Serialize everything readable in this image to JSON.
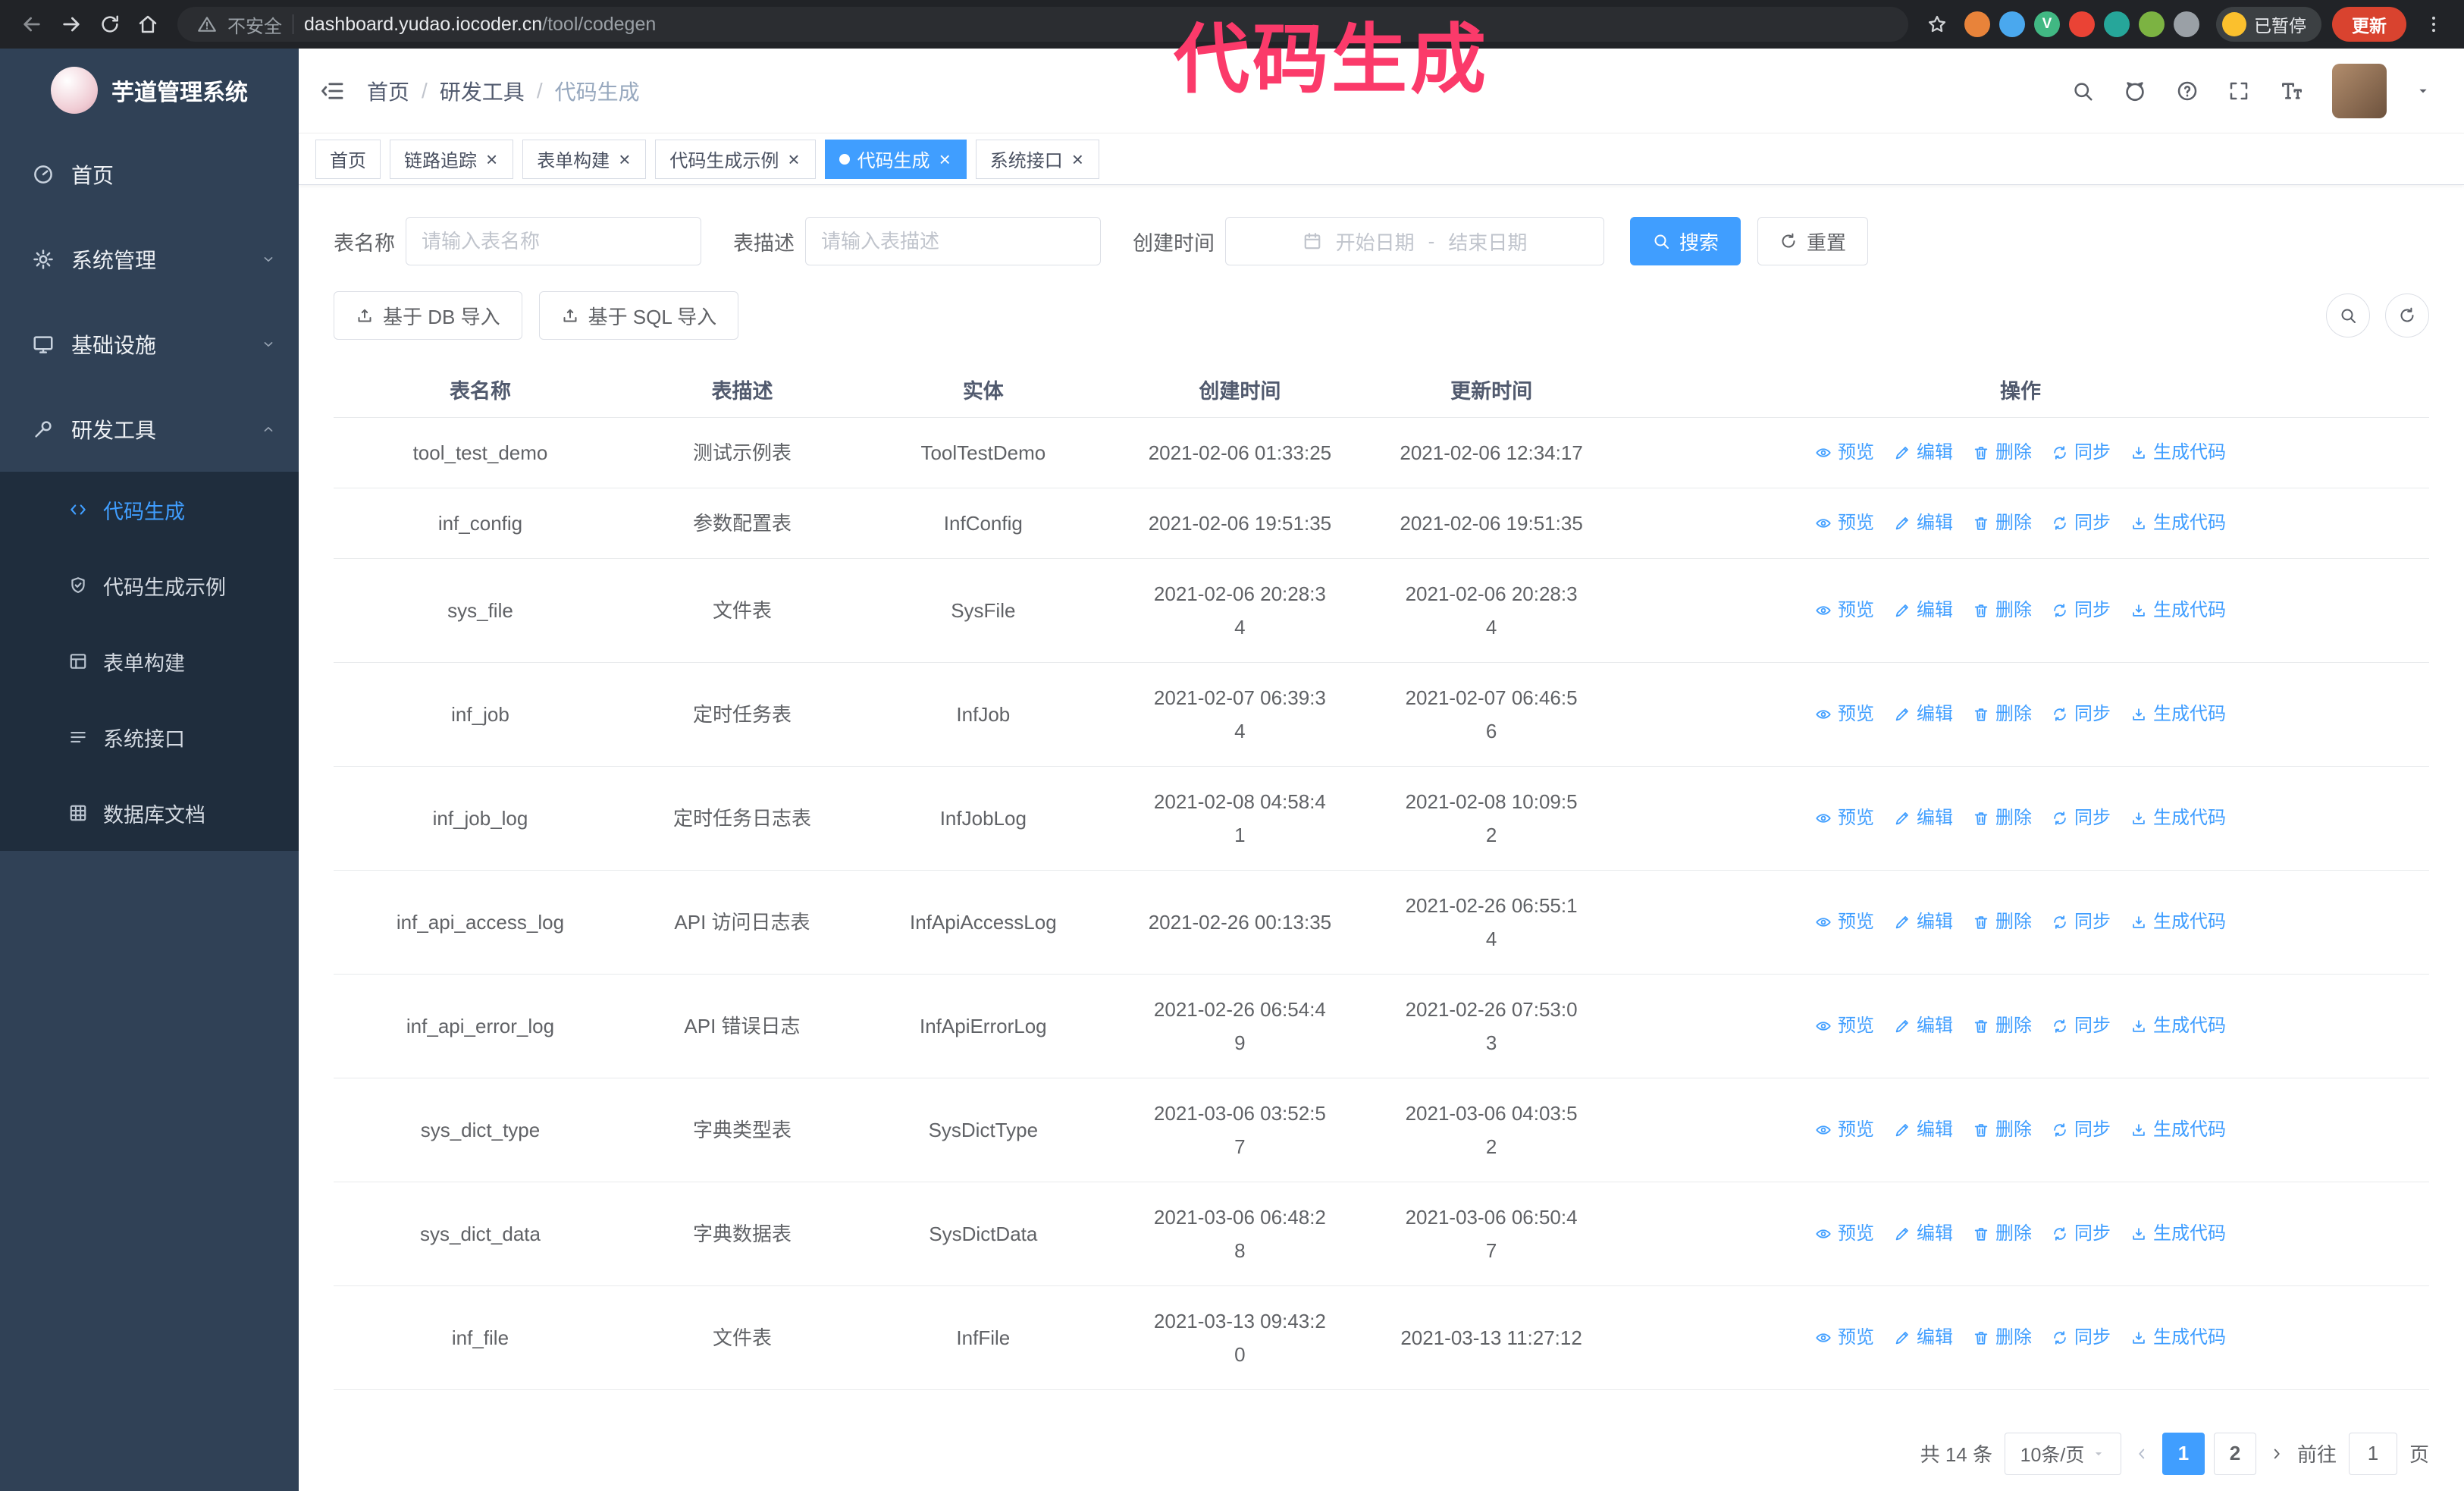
{
  "annotation": {
    "text": "代码生成"
  },
  "browser": {
    "security_label": "不安全",
    "url_host": "dashboard.yudao.iocoder.cn",
    "url_path": "/tool/codegen",
    "paused_badge": "已暂停",
    "update_label": "更新",
    "extensions": [
      {
        "name": "extension-1",
        "color": "#e8833a",
        "label": ""
      },
      {
        "name": "extension-2",
        "color": "#4aa8ee",
        "label": ""
      },
      {
        "name": "extension-3",
        "color": "#41b883",
        "label": "V"
      },
      {
        "name": "extension-4",
        "color": "#ea4335",
        "label": ""
      },
      {
        "name": "extension-5",
        "color": "#26a69a",
        "label": ""
      },
      {
        "name": "extension-6",
        "color": "#7cb342",
        "label": ""
      },
      {
        "name": "extension-7",
        "color": "#9aa0a6",
        "label": ""
      }
    ]
  },
  "sidebar": {
    "title": "芋道管理系统",
    "menu": [
      {
        "label": "首页",
        "icon": "dashboard",
        "arrow": ""
      },
      {
        "label": "系统管理",
        "icon": "gear",
        "arrow": "down"
      },
      {
        "label": "基础设施",
        "icon": "infra",
        "arrow": "down"
      },
      {
        "label": "研发工具",
        "icon": "tools",
        "arrow": "up"
      }
    ],
    "submenu": [
      {
        "label": "代码生成",
        "icon": "code",
        "active": true
      },
      {
        "label": "代码生成示例",
        "icon": "example",
        "active": false
      },
      {
        "label": "表单构建",
        "icon": "form",
        "active": false
      },
      {
        "label": "系统接口",
        "icon": "api",
        "active": false
      },
      {
        "label": "数据库文档",
        "icon": "db",
        "active": false
      }
    ]
  },
  "breadcrumb": {
    "items": [
      "首页",
      "研发工具",
      "代码生成"
    ],
    "separator": "/"
  },
  "tabs": [
    {
      "label": "首页",
      "closable": false,
      "active": false
    },
    {
      "label": "链路追踪",
      "closable": true,
      "active": false
    },
    {
      "label": "表单构建",
      "closable": true,
      "active": false
    },
    {
      "label": "代码生成示例",
      "closable": true,
      "active": false
    },
    {
      "label": "代码生成",
      "closable": true,
      "active": true
    },
    {
      "label": "系统接口",
      "closable": true,
      "active": false
    }
  ],
  "filters": {
    "name_label": "表名称",
    "name_placeholder": "请输入表名称",
    "desc_label": "表描述",
    "desc_placeholder": "请输入表描述",
    "time_label": "创建时间",
    "date_start": "开始日期",
    "date_sep": "-",
    "date_end": "结束日期",
    "search": "搜索",
    "reset": "重置"
  },
  "toolbar": {
    "import_db": "基于 DB 导入",
    "import_sql": "基于 SQL 导入"
  },
  "table": {
    "columns": [
      "表名称",
      "表描述",
      "实体",
      "创建时间",
      "更新时间",
      "操作"
    ],
    "action_labels": [
      {
        "name": "preview",
        "label": "预览",
        "icon": "eye"
      },
      {
        "name": "edit",
        "label": "编辑",
        "icon": "edit"
      },
      {
        "name": "delete",
        "label": "删除",
        "icon": "trash"
      },
      {
        "name": "sync",
        "label": "同步",
        "icon": "sync"
      },
      {
        "name": "generate",
        "label": "生成代码",
        "icon": "generate"
      }
    ],
    "rows": [
      {
        "name": "tool_test_demo",
        "desc": "测试示例表",
        "entity": "ToolTestDemo",
        "created": "2021-02-06 01:33:25",
        "updated": "2021-02-06 12:34:17"
      },
      {
        "name": "inf_config",
        "desc": "参数配置表",
        "entity": "InfConfig",
        "created": "2021-02-06 19:51:35",
        "updated": "2021-02-06 19:51:35"
      },
      {
        "name": "sys_file",
        "desc": "文件表",
        "entity": "SysFile",
        "created": "2021-02-06 20:28:3\n4",
        "updated": "2021-02-06 20:28:3\n4"
      },
      {
        "name": "inf_job",
        "desc": "定时任务表",
        "entity": "InfJob",
        "created": "2021-02-07 06:39:3\n4",
        "updated": "2021-02-07 06:46:5\n6"
      },
      {
        "name": "inf_job_log",
        "desc": "定时任务日志表",
        "entity": "InfJobLog",
        "created": "2021-02-08 04:58:4\n1",
        "updated": "2021-02-08 10:09:5\n2"
      },
      {
        "name": "inf_api_access_log",
        "desc": "API 访问日志表",
        "entity": "InfApiAccessLog",
        "created": "2021-02-26 00:13:35",
        "updated": "2021-02-26 06:55:1\n4"
      },
      {
        "name": "inf_api_error_log",
        "desc": "API 错误日志",
        "entity": "InfApiErrorLog",
        "created": "2021-02-26 06:54:4\n9",
        "updated": "2021-02-26 07:53:0\n3"
      },
      {
        "name": "sys_dict_type",
        "desc": "字典类型表",
        "entity": "SysDictType",
        "created": "2021-03-06 03:52:5\n7",
        "updated": "2021-03-06 04:03:5\n2"
      },
      {
        "name": "sys_dict_data",
        "desc": "字典数据表",
        "entity": "SysDictData",
        "created": "2021-03-06 06:48:2\n8",
        "updated": "2021-03-06 06:50:4\n7"
      },
      {
        "name": "inf_file",
        "desc": "文件表",
        "entity": "InfFile",
        "created": "2021-03-13 09:43:2\n0",
        "updated": "2021-03-13 11:27:12"
      }
    ]
  },
  "pagination": {
    "total": "共 14 条",
    "page_size": "10条/页",
    "pages": [
      {
        "label": "1",
        "active": true
      },
      {
        "label": "2",
        "active": false
      }
    ],
    "goto_label": "前往",
    "goto_value": "1",
    "goto_suffix": "页"
  }
}
